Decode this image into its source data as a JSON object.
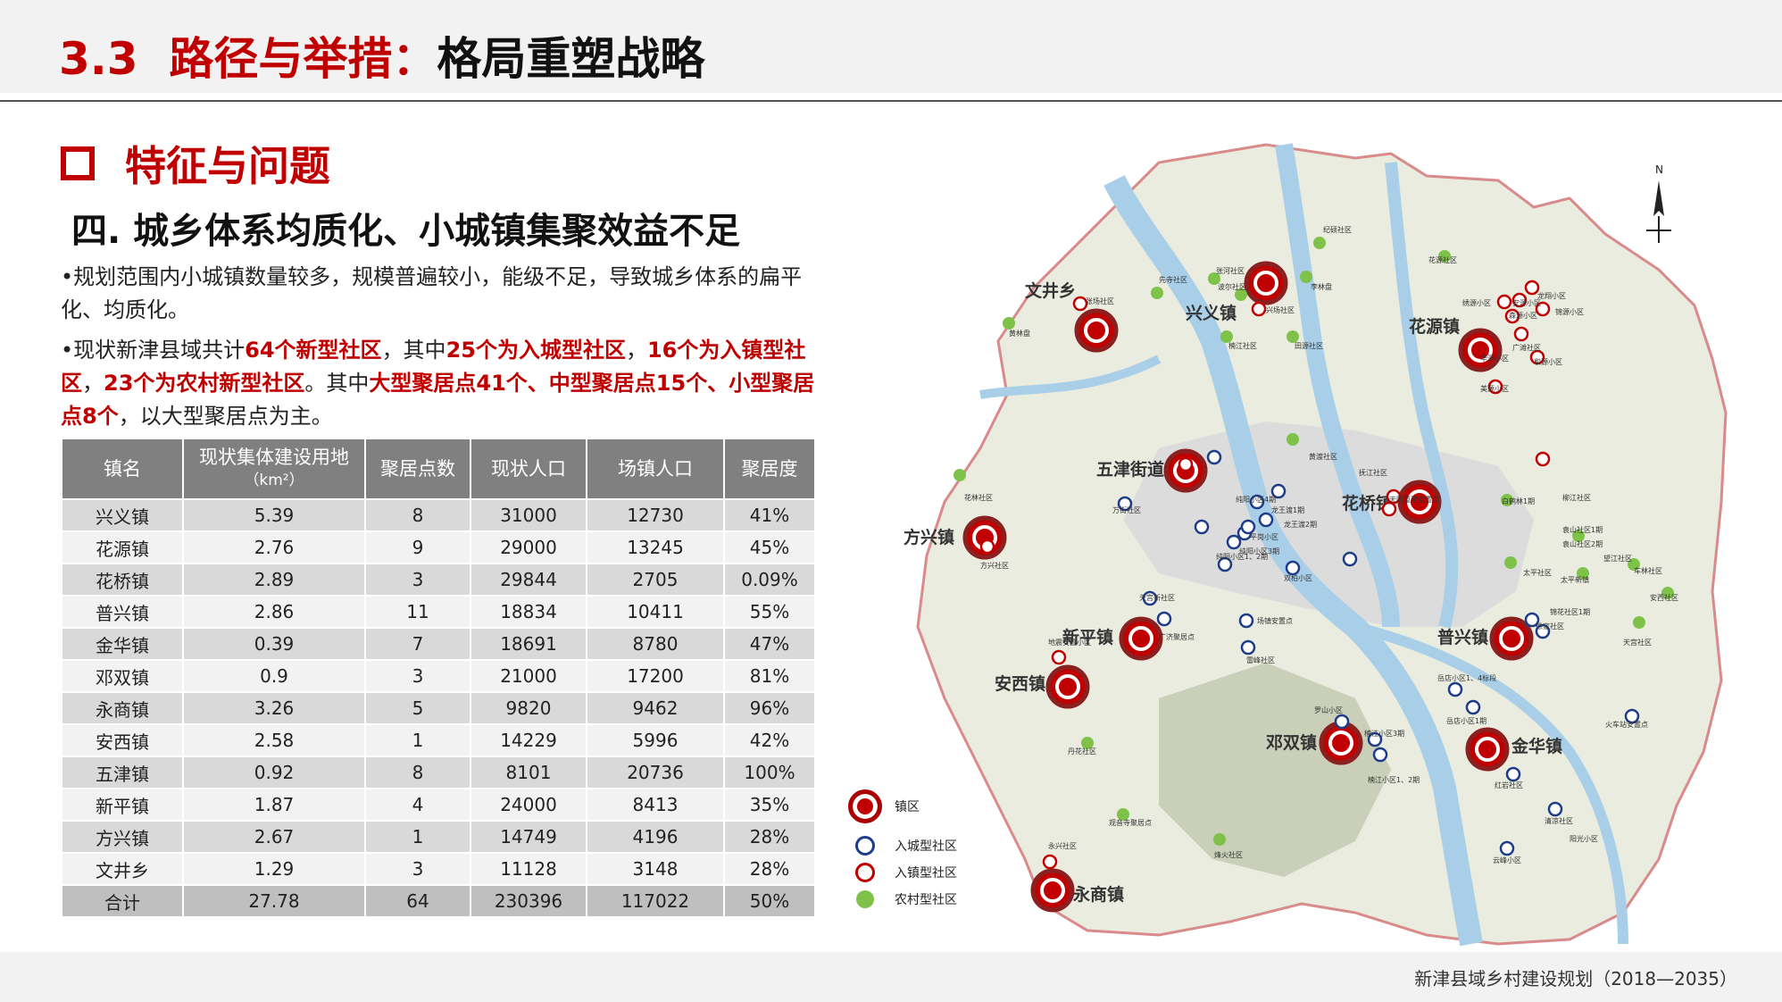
{
  "header": {
    "num": "3.3",
    "title_red": "路径与举措：",
    "title_black": "格局重塑战略"
  },
  "section": {
    "title": "特征与问题",
    "subtitle": "四. 城乡体系均质化、小城镇集聚效益不足"
  },
  "para1": "•规划范围内小城镇数量较多，规模普遍较小，能级不足，导致城乡体系的扁平化、均质化。",
  "para2": {
    "s1": "•现状新津县域共计",
    "s2": "64个新型社区",
    "s3": "，其中",
    "s4": "25个为入城型社区",
    "s5": "，",
    "s6": "16个为入镇型社区",
    "s7": "，",
    "s8": "23个为农村新型社区",
    "s9": "。其中",
    "s10": "大型聚居点41个、中型聚居点15个、小型聚居点8个",
    "s11": "，以大型聚居点为主。"
  },
  "table": {
    "headers": [
      "镇名",
      "现状集体建设用地",
      "（km²）",
      "聚居点数",
      "现状人口",
      "场镇人口",
      "聚居度"
    ],
    "rows": [
      [
        "兴义镇",
        "5.39",
        "8",
        "31000",
        "12730",
        "41%"
      ],
      [
        "花源镇",
        "2.76",
        "9",
        "29000",
        "13245",
        "45%"
      ],
      [
        "花桥镇",
        "2.89",
        "3",
        "29844",
        "2705",
        "0.09%"
      ],
      [
        "普兴镇",
        "2.86",
        "11",
        "18834",
        "10411",
        "55%"
      ],
      [
        "金华镇",
        "0.39",
        "7",
        "18691",
        "8780",
        "47%"
      ],
      [
        "邓双镇",
        "0.9",
        "3",
        "21000",
        "17200",
        "81%"
      ],
      [
        "永商镇",
        "3.26",
        "5",
        "9820",
        "9462",
        "96%"
      ],
      [
        "安西镇",
        "2.58",
        "1",
        "14229",
        "5996",
        "42%"
      ],
      [
        "五津镇",
        "0.92",
        "8",
        "8101",
        "20736",
        "100%"
      ],
      [
        "新平镇",
        "1.87",
        "4",
        "24000",
        "8413",
        "35%"
      ],
      [
        "方兴镇",
        "2.67",
        "1",
        "14749",
        "4196",
        "28%"
      ],
      [
        "文井乡",
        "1.29",
        "3",
        "11128",
        "3148",
        "28%"
      ]
    ],
    "total": [
      "合计",
      "27.78",
      "64",
      "230396",
      "117022",
      "50%"
    ]
  },
  "map": {
    "north": "N",
    "towns": [
      "文井乡",
      "兴义镇",
      "花源镇",
      "五津街道",
      "花桥镇",
      "方兴镇",
      "新平镇",
      "安西镇",
      "普兴镇",
      "邓双镇",
      "金华镇",
      "永商镇"
    ],
    "small_labels": [
      "张场社区",
      "先寺社区",
      "张河社区",
      "波尔社区",
      "兴场社区",
      "李林盘",
      "纪硕社区",
      "黄林盘",
      "楠江社区",
      "田源社区",
      "花源社区",
      "绣源小区",
      "安源小区",
      "森源小区",
      "龙翔小区",
      "锦源小区",
      "华源小区",
      "和源小区",
      "美源小区",
      "广滩社区",
      "黄渡社区",
      "花林社区",
      "万街社区",
      "纯阳小区4期",
      "龙王渡1期",
      "龙王渡2期",
      "平岗小区",
      "纯阳小区3期",
      "纯阳小区1、2期",
      "双柏小区",
      "抚江社区",
      "天阳重建安置点",
      "白鹤林1期",
      "柳江社区",
      "袁山社区1期",
      "袁山社区2期",
      "方兴社区",
      "太平社区",
      "太平新镇",
      "望江社区",
      "车林社区",
      "安西社区",
      "锦花社区1期",
      "徐家社区",
      "天宫社区",
      "天宫新社区",
      "广济聚居点",
      "地震安置小区",
      "场镇安置点",
      "雷峰社区",
      "岳店小区1、4标段",
      "岳店小区1期",
      "罗山小区",
      "楠江小区3期",
      "楠江小区1、2期",
      "红岩社区",
      "清凉社区",
      "火车站安置点",
      "阳光小区",
      "云峰小区",
      "丹花社区",
      "观音寺聚居点",
      "烽火社区",
      "永兴社区"
    ]
  },
  "legend": [
    "镇区",
    "入城型社区",
    "入镇型社区",
    "农村型社区"
  ],
  "footer": "新津县域乡村建设规划（2018—2035）",
  "colors": {
    "accent": "#c00000",
    "header_bg": "#f2f2f2",
    "table_header": "#808080",
    "city_ring": "#1f3c88",
    "rural": "#7fc24a"
  }
}
